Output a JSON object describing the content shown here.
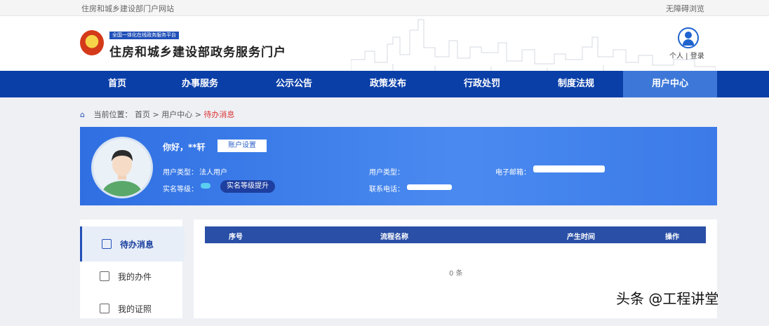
{
  "topbar": {
    "left": "住房和城乡建设部门户网站",
    "right": "无障碍浏览"
  },
  "header": {
    "platform_tag": "全国一体化在线政务服务平台",
    "site_title": "住房和城乡建设部政务服务门户",
    "user_links": "个人 | 登录"
  },
  "nav": [
    "首页",
    "办事服务",
    "公示公告",
    "政策发布",
    "行政处罚",
    "制度法规",
    "用户中心"
  ],
  "breadcrumb": {
    "prefix": "当前位置：",
    "path": "首页 > 用户中心 > ",
    "current": "待办消息"
  },
  "profile": {
    "greeting": "你好，**轩",
    "account_settings": "账户设置",
    "user_type_label": "用户类型：",
    "user_type_value": "法人用户",
    "user_name_label": "用户类型：",
    "email_label": "电子邮箱：",
    "verify_label": "实名等级：",
    "verify_button": "实名等级提升",
    "phone_label": "联系电话："
  },
  "sidebar": [
    {
      "label": "待办消息",
      "icon": "message-icon"
    },
    {
      "label": "我的办件",
      "icon": "document-icon"
    },
    {
      "label": "我的证照",
      "icon": "id-card-icon"
    }
  ],
  "table": {
    "headers": [
      "序号",
      "流程名称",
      "产生时间",
      "操作"
    ],
    "empty_text": "0 条"
  },
  "watermark": "头条 @工程讲堂",
  "colors": {
    "nav": "#0a3fa8",
    "nav_active": "#3d78d8",
    "profile": "#3b7ae8",
    "table_header": "#2a4fa6"
  }
}
